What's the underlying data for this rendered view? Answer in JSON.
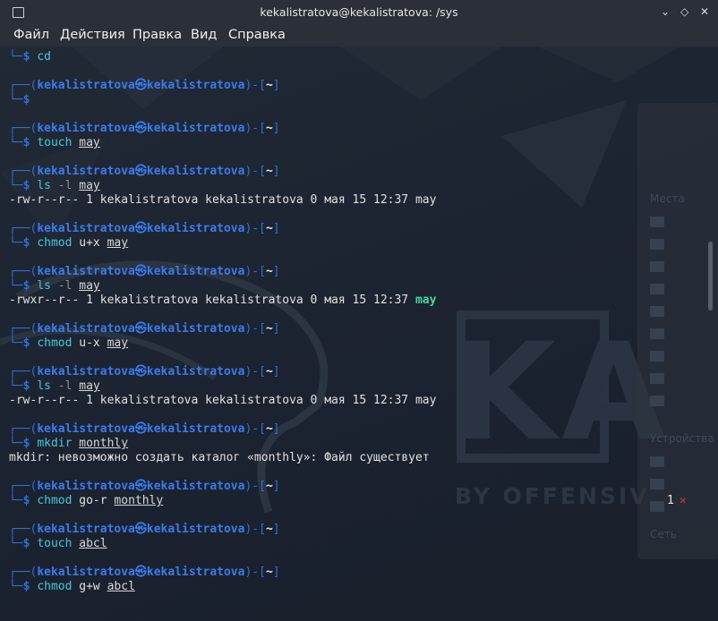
{
  "window": {
    "title": "kekalistratova@kekalistratova: /sys",
    "buttons": {
      "minimize": "⌄",
      "maximize": "◇",
      "close": "✕"
    }
  },
  "menu": [
    "Файл",
    "Действия",
    "Правка",
    "Вид",
    "Справка"
  ],
  "prompt": {
    "user": "kekalistratova",
    "at": "㉿",
    "host": "kekalistratova",
    "dir": "~"
  },
  "terminal_lines": [
    {
      "type": "cmd",
      "cmd": "cd",
      "opts": "",
      "args": ""
    },
    {
      "type": "blank"
    },
    {
      "type": "prompt"
    },
    {
      "type": "cmd",
      "cmd": "",
      "opts": "",
      "args": ""
    },
    {
      "type": "blank"
    },
    {
      "type": "prompt"
    },
    {
      "type": "cmd",
      "cmd": "touch",
      "opts": "",
      "args": "may"
    },
    {
      "type": "blank"
    },
    {
      "type": "prompt"
    },
    {
      "type": "cmd",
      "cmd": "ls",
      "opts": "-l",
      "args": "may"
    },
    {
      "type": "out",
      "text": "-rw-r--r-- 1 kekalistratova kekalistratova 0 мая 15 12:37 may"
    },
    {
      "type": "blank"
    },
    {
      "type": "prompt"
    },
    {
      "type": "cmd",
      "cmd": "chmod",
      "opts": "u+x",
      "args": "may"
    },
    {
      "type": "blank"
    },
    {
      "type": "prompt"
    },
    {
      "type": "cmd",
      "cmd": "ls",
      "opts": "-l",
      "args": "may"
    },
    {
      "type": "out",
      "text": "-rwxr--r-- 1 kekalistratova kekalistratova 0 мая 15 12:37 ",
      "exec": "may"
    },
    {
      "type": "blank"
    },
    {
      "type": "prompt"
    },
    {
      "type": "cmd",
      "cmd": "chmod",
      "opts": "u-x",
      "args": "may"
    },
    {
      "type": "blank"
    },
    {
      "type": "prompt"
    },
    {
      "type": "cmd",
      "cmd": "ls",
      "opts": "-l",
      "args": "may"
    },
    {
      "type": "out",
      "text": "-rw-r--r-- 1 kekalistratova kekalistratova 0 мая 15 12:37 may"
    },
    {
      "type": "blank"
    },
    {
      "type": "prompt"
    },
    {
      "type": "cmd",
      "cmd": "mkdir",
      "opts": "",
      "args": "monthly"
    },
    {
      "type": "out",
      "text": "mkdir: невозможно создать каталог «monthly»: Файл существует"
    },
    {
      "type": "blank"
    },
    {
      "type": "prompt"
    },
    {
      "type": "cmd",
      "cmd": "chmod",
      "opts": "go-r",
      "args": "monthly"
    },
    {
      "type": "blank"
    },
    {
      "type": "prompt"
    },
    {
      "type": "cmd",
      "cmd": "touch",
      "opts": "",
      "args": "abcl"
    },
    {
      "type": "blank"
    },
    {
      "type": "prompt"
    },
    {
      "type": "cmd",
      "cmd": "chmod",
      "opts": "g+w",
      "args": "abcl"
    }
  ],
  "exit_status": {
    "code": "1",
    "mark": "✕"
  },
  "wallpaper": {
    "logo_text": "KA",
    "slogan": "BY OFFENSIV"
  },
  "background_window": {
    "items": [
      "Места",
      "Устройства",
      "Сеть"
    ]
  },
  "colors": {
    "frame": "#2f6fd6",
    "user": "#3b7bec",
    "command": "#47c8d9",
    "executable": "#49d3a4",
    "error_mark": "#e03535"
  }
}
